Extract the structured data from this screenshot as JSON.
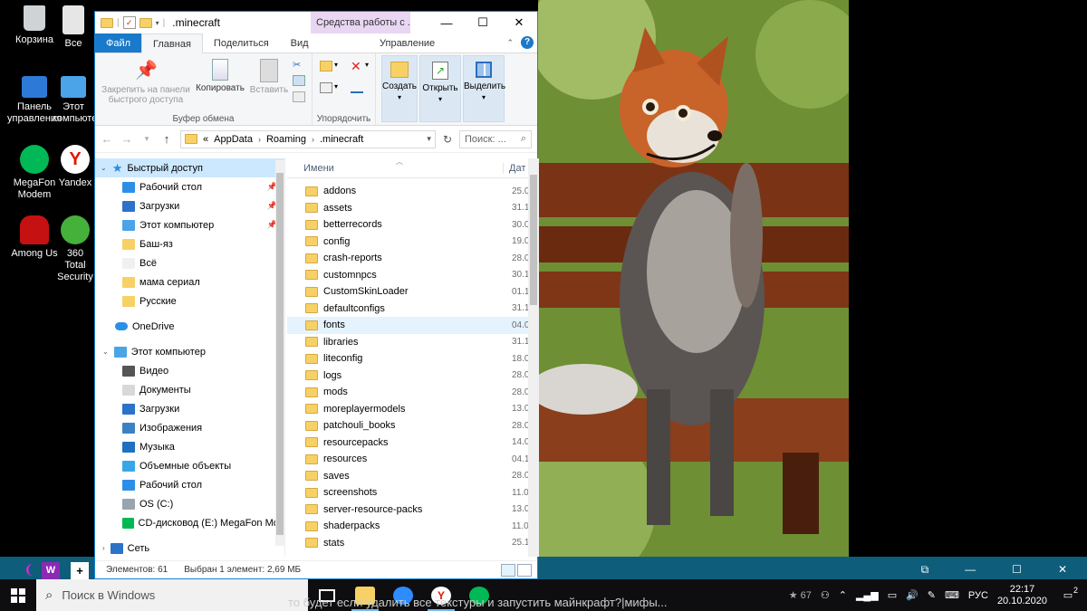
{
  "desktop": {
    "icons": [
      {
        "label": "Корзина",
        "icon": "recycle-bin-icon",
        "color": "#d8d8d8"
      },
      {
        "label": "Все",
        "icon": "document-icon",
        "color": "#e6e6e6"
      },
      {
        "label": "Панель управления",
        "icon": "control-panel-icon",
        "color": "#2d7ad6"
      },
      {
        "label": "Этот компьютер",
        "icon": "computer-icon",
        "color": "#4ba3e8"
      },
      {
        "label": "MegaFon Modem",
        "icon": "megafon-icon",
        "color": "#00b956"
      },
      {
        "label": "Yandex",
        "icon": "yandex-icon",
        "color": "#ffffff"
      },
      {
        "label": "Among Us",
        "icon": "among-us-icon",
        "color": "#c51111"
      },
      {
        "label": "360 Total Security",
        "icon": "security-icon",
        "color": "#45b03a"
      }
    ]
  },
  "window": {
    "title": ".minecraft",
    "context_tab": "Средства работы с ...",
    "controls": {
      "minimize": "—",
      "maximize": "☐",
      "close": "✕"
    },
    "tabs": {
      "file": "Файл",
      "home": "Главная",
      "share": "Поделиться",
      "view": "Вид",
      "manage": "Управление"
    },
    "ribbon": {
      "pin": "Закрепить на панели быстрого доступа",
      "copy": "Копировать",
      "paste": "Вставить",
      "clipboard_group": "Буфер обмена",
      "organize_group": "Упорядочить",
      "create": "Создать",
      "open": "Открыть",
      "select": "Выделить"
    },
    "address": {
      "prefix": "«",
      "path": [
        "AppData",
        "Roaming",
        ".minecraft"
      ],
      "search_placeholder": "Поиск: ..."
    },
    "nav": {
      "quick_access": "Быстрый доступ",
      "quick_items": [
        {
          "label": "Рабочий стол",
          "pinned": true,
          "color": "#2b8fe8"
        },
        {
          "label": "Загрузки",
          "pinned": true,
          "color": "#2b72c8"
        },
        {
          "label": "Этот компьютер",
          "pinned": true,
          "color": "#4ba3e8"
        },
        {
          "label": "Баш-яз",
          "pinned": false,
          "color": "#f7d165"
        },
        {
          "label": "Всё",
          "pinned": false,
          "color": "#f0f0f0"
        },
        {
          "label": "мама сериал",
          "pinned": false,
          "color": "#f7d165"
        },
        {
          "label": "Русские",
          "pinned": false,
          "color": "#f7d165"
        }
      ],
      "onedrive": "OneDrive",
      "this_pc": "Этот компьютер",
      "pc_items": [
        {
          "label": "Видео",
          "color": "#555555"
        },
        {
          "label": "Документы",
          "color": "#d8d8d8"
        },
        {
          "label": "Загрузки",
          "color": "#2b72c8"
        },
        {
          "label": "Изображения",
          "color": "#3b82c4"
        },
        {
          "label": "Музыка",
          "color": "#1f6fc2"
        },
        {
          "label": "Объемные объекты",
          "color": "#37a6e8"
        },
        {
          "label": "Рабочий стол",
          "color": "#2b8fe8"
        },
        {
          "label": "OS (C:)",
          "color": "#9aa4ad"
        },
        {
          "label": "CD-дисковод (E:) MegaFon Mod",
          "color": "#00b956"
        }
      ],
      "network": "Сеть"
    },
    "list": {
      "col_name": "Имени",
      "col_date": "Дат",
      "rows": [
        {
          "name": "addons",
          "date": "25.0"
        },
        {
          "name": "assets",
          "date": "31.1"
        },
        {
          "name": "betterrecords",
          "date": "30.0"
        },
        {
          "name": "config",
          "date": "19.0"
        },
        {
          "name": "crash-reports",
          "date": "28.0"
        },
        {
          "name": "customnpcs",
          "date": "30.1"
        },
        {
          "name": "CustomSkinLoader",
          "date": "01.1"
        },
        {
          "name": "defaultconfigs",
          "date": "31.1"
        },
        {
          "name": "fonts",
          "date": "04.0",
          "selected": true
        },
        {
          "name": "libraries",
          "date": "31.1"
        },
        {
          "name": "liteconfig",
          "date": "18.0"
        },
        {
          "name": "logs",
          "date": "28.0"
        },
        {
          "name": "mods",
          "date": "28.0"
        },
        {
          "name": "moreplayermodels",
          "date": "13.0"
        },
        {
          "name": "patchouli_books",
          "date": "28.0"
        },
        {
          "name": "resourcepacks",
          "date": "14.0"
        },
        {
          "name": "resources",
          "date": "04.1"
        },
        {
          "name": "saves",
          "date": "28.0"
        },
        {
          "name": "screenshots",
          "date": "11.0"
        },
        {
          "name": "server-resource-packs",
          "date": "13.0"
        },
        {
          "name": "shaderpacks",
          "date": "11.0"
        },
        {
          "name": "stats",
          "date": "25.1"
        }
      ]
    },
    "status": {
      "count": "Элементов: 61",
      "selected": "Выбран 1 элемент: 2,69 МБ"
    }
  },
  "taskbar": {
    "search_placeholder": "Поиск в Windows",
    "behind_text": "то будет если удалить все текстуры и запустить майнкрафт?|мифы...",
    "tray_left": "★ 67",
    "lang": "РУС",
    "time": "22:17",
    "date": "20.10.2020",
    "notifications": "2"
  },
  "colors": {
    "accent": "#1979ca",
    "selection": "#cce8ff",
    "folder": "#f7d165"
  }
}
